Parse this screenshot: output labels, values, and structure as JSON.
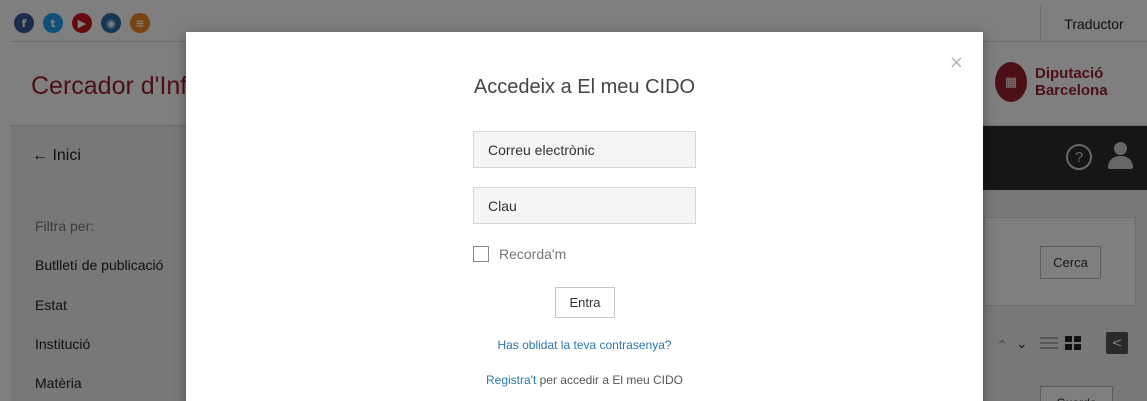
{
  "topbar": {
    "social_icons": [
      {
        "name": "facebook",
        "color": "#3b5998",
        "glyph": "f"
      },
      {
        "name": "twitter",
        "color": "#1da1f2",
        "glyph": "t"
      },
      {
        "name": "youtube",
        "color": "#cc181e",
        "glyph": "▶"
      },
      {
        "name": "instagram",
        "color": "#2b6ea8",
        "glyph": "◉"
      },
      {
        "name": "rss",
        "color": "#f2891f",
        "glyph": "≋"
      }
    ],
    "translator_label": "Traductor"
  },
  "brand": {
    "site_title": "Cercador d'Inf",
    "org_line1": "Diputació",
    "org_line2": "Barcelona"
  },
  "nav": {
    "home_label": "← Inici",
    "help_glyph": "?"
  },
  "sidebar": {
    "filter_title": "Filtra per:",
    "items": [
      "Butlletí de publicació",
      "Estat",
      "Institució",
      "Matèria"
    ]
  },
  "search": {
    "button_label": "Cerca"
  },
  "results_toolbar": {
    "chevron_up": "⌃",
    "chevron_down": "⌄",
    "share_glyph": "<",
    "save_label": "Guarda"
  },
  "modal": {
    "close_glyph": "×",
    "title": "Accedeix a El meu CIDO",
    "email_placeholder": "Correu electrònic",
    "password_placeholder": "Clau",
    "remember_label": "Recorda'm",
    "login_label": "Entra",
    "forgot_link": "Has oblidat la teva contrasenya?",
    "register_link": "Registra't",
    "register_suffix": " per accedir a El meu CIDO"
  },
  "colors": {
    "brand_red": "#9a1f2c",
    "link_blue": "#2a7ab0",
    "navbar_dark": "#2c2c2c"
  }
}
